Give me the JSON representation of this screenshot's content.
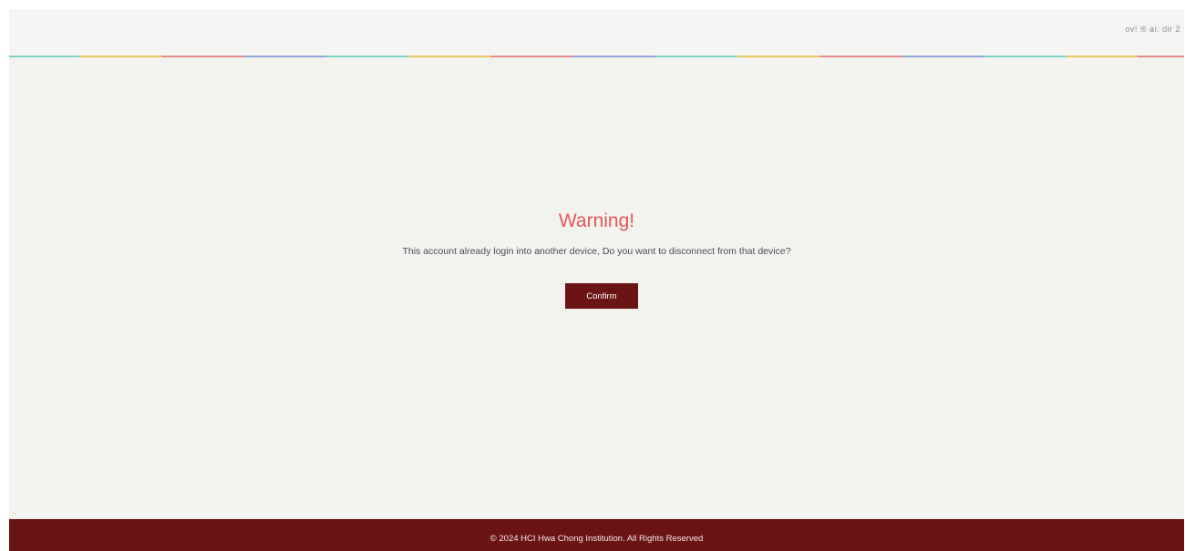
{
  "header": {
    "right_text": "ov! ® ai: dir 2"
  },
  "dialog": {
    "title": "Warning!",
    "message": "This account already login into another device, Do you want to disconnect from that device?",
    "confirm_label": "Confirm"
  },
  "footer": {
    "copyright": "© 2024 HCI Hwa Chong Institution. All Rights Reserved"
  },
  "colors": {
    "title": "#e05a5a",
    "primary": "#6b1414",
    "background": "#f2f2ef"
  }
}
